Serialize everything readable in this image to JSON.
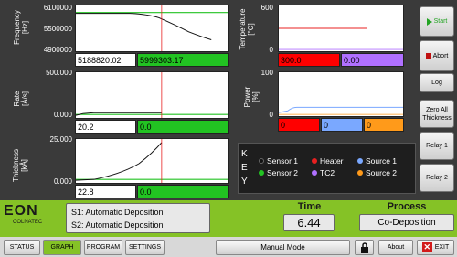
{
  "charts": {
    "frequency": {
      "ylabel": "Frequency\n[Hz]",
      "yticks": [
        "6100000",
        "5500000",
        "4900000"
      ],
      "values": [
        "5188820.02",
        "5999303.17"
      ]
    },
    "rate": {
      "ylabel": "Rate\n[Å/s]",
      "yticks": [
        "500.000",
        "0.000"
      ],
      "values": [
        "20.2",
        "0.0"
      ]
    },
    "thickness": {
      "ylabel": "Thickness\n[kÅ]",
      "yticks": [
        "25.000",
        "0.000"
      ],
      "values": [
        "22.8",
        "0.0"
      ]
    },
    "temperature": {
      "ylabel": "Temperature\n[°C]",
      "yticks": [
        "600",
        "0"
      ],
      "values": [
        "300.0",
        "0.00"
      ]
    },
    "power": {
      "ylabel": "Power\n[%]",
      "yticks": [
        "100",
        "0"
      ],
      "values": [
        "0",
        "0",
        "0"
      ]
    }
  },
  "key": {
    "letters": [
      "K",
      "E",
      "Y"
    ],
    "items": [
      {
        "label": "Sensor 1",
        "color": "#111111"
      },
      {
        "label": "Heater",
        "color": "#e82020"
      },
      {
        "label": "Source 1",
        "color": "#7aa8ff"
      },
      {
        "label": "Sensor 2",
        "color": "#22c322"
      },
      {
        "label": "TC2",
        "color": "#b070ff"
      },
      {
        "label": "Source 2",
        "color": "#ff9a1a"
      }
    ]
  },
  "side": {
    "start": "Start",
    "abort": "Abort",
    "log": "Log",
    "zero": "Zero All Thickness",
    "relay1": "Relay 1",
    "relay2": "Relay 2"
  },
  "status": {
    "brand": "EON",
    "brand_sub": "COLNATEC",
    "s1": "S1: Automatic Deposition",
    "s2": "S2: Automatic Deposition",
    "time_label": "Time",
    "time_value": "6.44",
    "process_label": "Process",
    "process_value": "Co-Deposition"
  },
  "tabs": {
    "status": "STATUS",
    "graph": "GRAPH",
    "program": "PROGRAM",
    "settings": "SETTINGS",
    "manual": "Manual Mode",
    "about": "About",
    "exit": "EXIT"
  },
  "colors": {
    "accent": "#85c226",
    "red": "#ff0000",
    "green": "#22c322",
    "purple": "#b070ff",
    "orange": "#ff9a1a"
  }
}
